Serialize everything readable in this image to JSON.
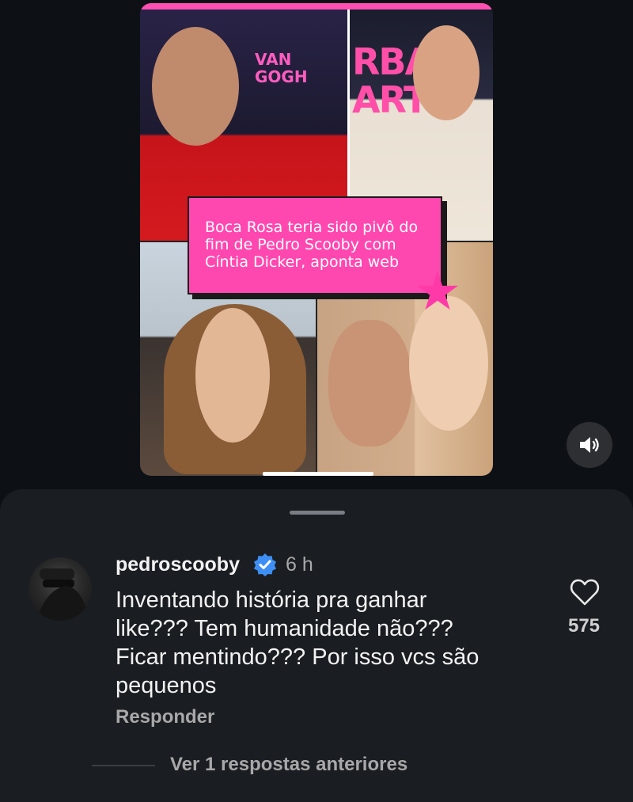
{
  "post": {
    "caption_lines": [
      "Boca Rosa teria sido pivô do",
      "fim de Pedro Scooby com",
      "Cíntia Dicker, aponta web"
    ],
    "background_text_left": [
      "VAN",
      "GOGH"
    ],
    "background_text_right": [
      "RBAN",
      "ART"
    ],
    "accent_color": "#ff47b0",
    "volume_icon": "speaker-on-icon"
  },
  "comment": {
    "username": "pedroscooby",
    "verified": true,
    "time": "6 h",
    "text_lines": [
      "Inventando história pra ganhar",
      "like??? Tem humanidade não???",
      "Ficar mentindo??? Por isso vcs são",
      "pequenos"
    ],
    "reply_label": "Responder",
    "like_count": "575",
    "heart_icon": "heart-outline-icon"
  },
  "view_replies_label": "Ver 1 respostas anteriores"
}
